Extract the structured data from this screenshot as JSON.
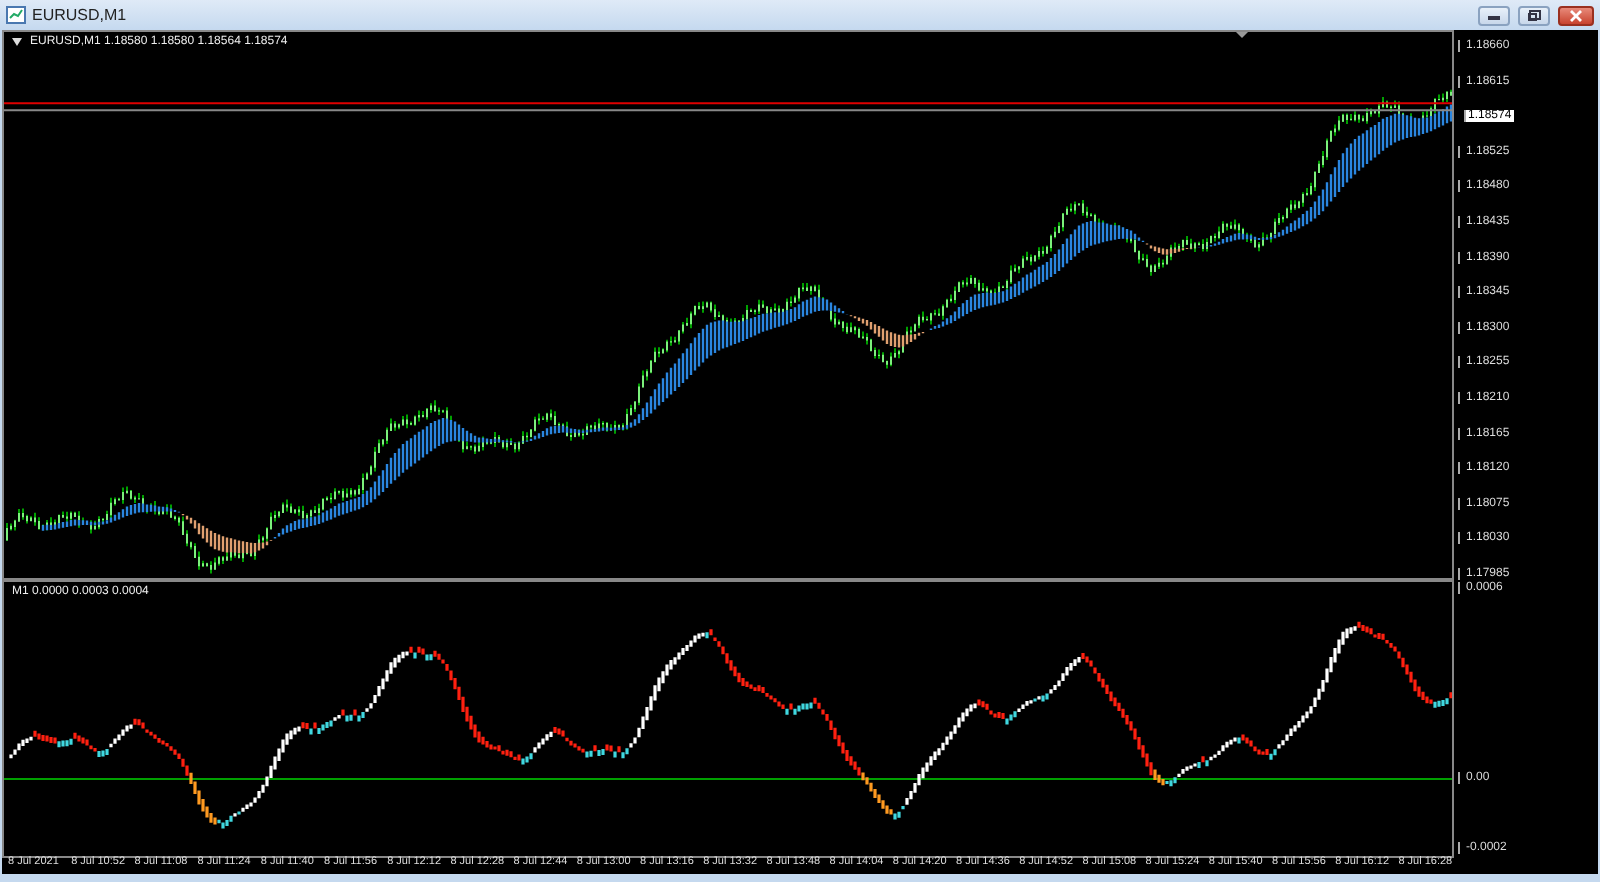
{
  "window": {
    "title": "EURUSD,M1"
  },
  "main_pane": {
    "header": "EURUSD,M1  1.18580 1.18580 1.18564 1.18574",
    "price_labels": [
      "1.18660",
      "1.18615",
      "1.18525",
      "1.18480",
      "1.18435",
      "1.18390",
      "1.18345",
      "1.18300",
      "1.18255",
      "1.18210",
      "1.18165",
      "1.18120",
      "1.18075",
      "1.18030",
      "1.17985"
    ],
    "current_price": "1.18574"
  },
  "sub_pane": {
    "header": "M1 0.0000 0.0003 0.0004",
    "scale_labels": [
      "0.0006",
      "0.00",
      "-0.0002"
    ]
  },
  "time_labels": [
    "8 Jul 2021",
    "8 Jul 10:52",
    "8 Jul 11:08",
    "8 Jul 11:24",
    "8 Jul 11:40",
    "8 Jul 11:56",
    "8 Jul 12:12",
    "8 Jul 12:28",
    "8 Jul 12:44",
    "8 Jul 13:00",
    "8 Jul 13:16",
    "8 Jul 13:32",
    "8 Jul 13:48",
    "8 Jul 14:04",
    "8 Jul 14:20",
    "8 Jul 14:36",
    "8 Jul 14:52",
    "8 Jul 15:08",
    "8 Jul 15:24",
    "8 Jul 15:40",
    "8 Jul 15:56",
    "8 Jul 16:12",
    "8 Jul 16:28"
  ]
}
